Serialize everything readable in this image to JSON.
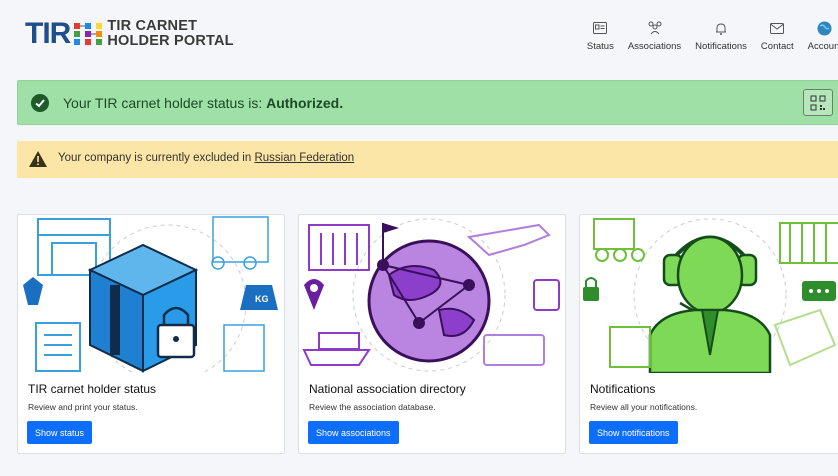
{
  "header": {
    "logo_mark_text": "TIR",
    "logo_line1": "TIR CARNET",
    "logo_line2": "HOLDER PORTAL",
    "nav": [
      {
        "label": "Status",
        "icon": "id-card-icon"
      },
      {
        "label": "Associations",
        "icon": "people-icon"
      },
      {
        "label": "Notifications",
        "icon": "bell-icon"
      },
      {
        "label": "Contact",
        "icon": "envelope-icon"
      },
      {
        "label": "Account",
        "icon": "globe-avatar-icon"
      }
    ]
  },
  "status_alert": {
    "prefix": "Your TIR carnet holder status is: ",
    "status": "Authorized."
  },
  "warning_alert": {
    "text": "Your company is currently excluded in ",
    "link": "Russian Federation"
  },
  "cards": [
    {
      "title": "TIR carnet holder status",
      "description": "Review and print your status.",
      "button": "Show status"
    },
    {
      "title": "National association directory",
      "description": "Review the association database.",
      "button": "Show associations"
    },
    {
      "title": "Notifications",
      "description": "Review all your notifications.",
      "button": "Show notifications"
    }
  ],
  "colors": {
    "primary": "#0d6efd",
    "success_bg": "#9ee0a6",
    "warning_bg": "#fbe6a7",
    "brand_blue": "#1f4e8c"
  },
  "illustrations": {
    "card1_tag": "KG"
  }
}
